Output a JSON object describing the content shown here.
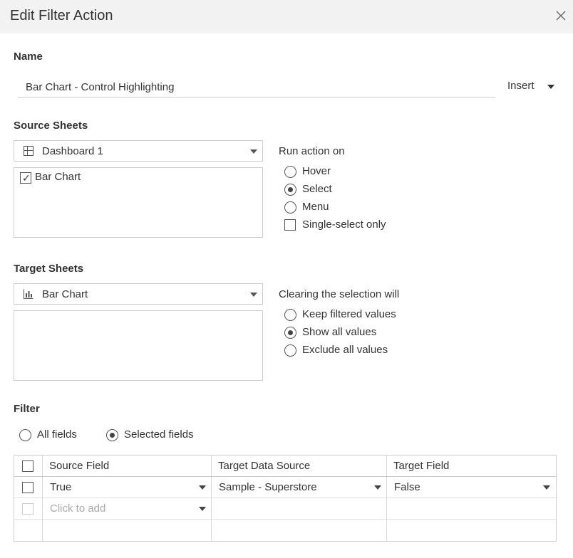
{
  "dialog": {
    "title": "Edit Filter Action"
  },
  "name_section": {
    "label": "Name",
    "value": "Bar Chart - Control Highlighting",
    "insert_label": "Insert"
  },
  "source": {
    "label": "Source Sheets",
    "dropdown_value": "Dashboard 1",
    "dropdown_icon": "dashboard-grid-icon",
    "sheets": [
      {
        "label": "Bar Chart",
        "checked": true
      }
    ]
  },
  "run_action": {
    "label": "Run action on",
    "options": [
      "Hover",
      "Select",
      "Menu"
    ],
    "selected": "Select",
    "single_select_label": "Single-select only",
    "single_select_checked": false
  },
  "target": {
    "label": "Target Sheets",
    "dropdown_value": "Bar Chart",
    "dropdown_icon": "bar-chart-icon"
  },
  "clearing": {
    "label": "Clearing the selection will",
    "options": [
      "Keep filtered values",
      "Show all values",
      "Exclude all values"
    ],
    "selected": "Show all values"
  },
  "filter": {
    "label": "Filter",
    "options": [
      "All fields",
      "Selected fields"
    ],
    "selected": "Selected fields",
    "columns": [
      "Source Field",
      "Target Data Source",
      "Target Field"
    ],
    "rows": [
      {
        "source_field": "True",
        "target_data_source": "Sample - Superstore",
        "target_field": "False"
      }
    ],
    "add_placeholder": "Click to add"
  },
  "colors": {
    "titlebar": "#f2f2f2",
    "border": "#cccccc",
    "text": "#333333"
  }
}
